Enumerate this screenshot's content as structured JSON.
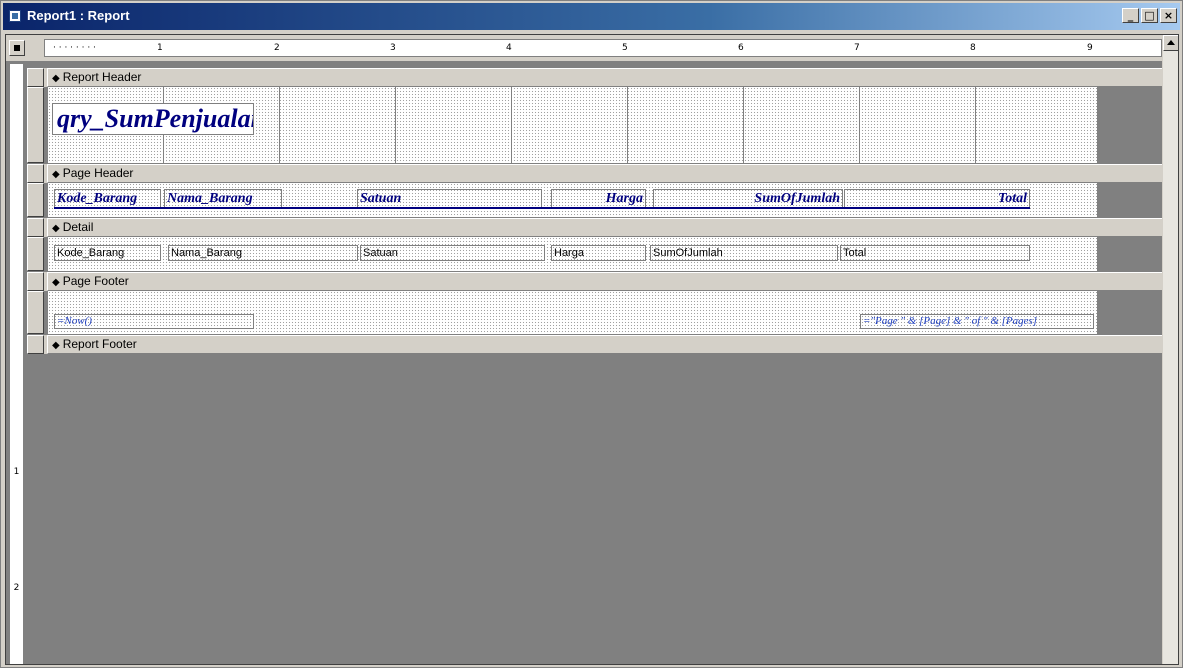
{
  "window": {
    "title": "Report1 : Report",
    "minimize": "_",
    "maximize": "□",
    "close": "×"
  },
  "ruler": {
    "h_marks": [
      "1",
      "2",
      "3",
      "4",
      "5",
      "6",
      "7",
      "8",
      "9"
    ],
    "v_marks": [
      "1",
      "2"
    ]
  },
  "sections": {
    "report_header": "Report Header",
    "page_header": "Page Header",
    "detail": "Detail",
    "page_footer": "Page Footer",
    "report_footer": "Report Footer"
  },
  "report_header": {
    "title_label": "qry_SumPenjualanpr"
  },
  "page_header": {
    "labels": [
      "Kode_Barang",
      "Nama_Barang",
      "Satuan",
      "Harga",
      "SumOfJumlah",
      "Total"
    ]
  },
  "detail": {
    "fields": [
      "Kode_Barang",
      "Nama_Barang",
      "Satuan",
      "Harga",
      "SumOfJumlah",
      "Total"
    ]
  },
  "page_footer": {
    "date_expr": "=Now()",
    "page_expr": "=\"Page \" & [Page] & \" of \" & [Pages]"
  },
  "colors": {
    "title_bar": "#0a246a",
    "label_text": "#00007f",
    "workspace": "#808080"
  }
}
